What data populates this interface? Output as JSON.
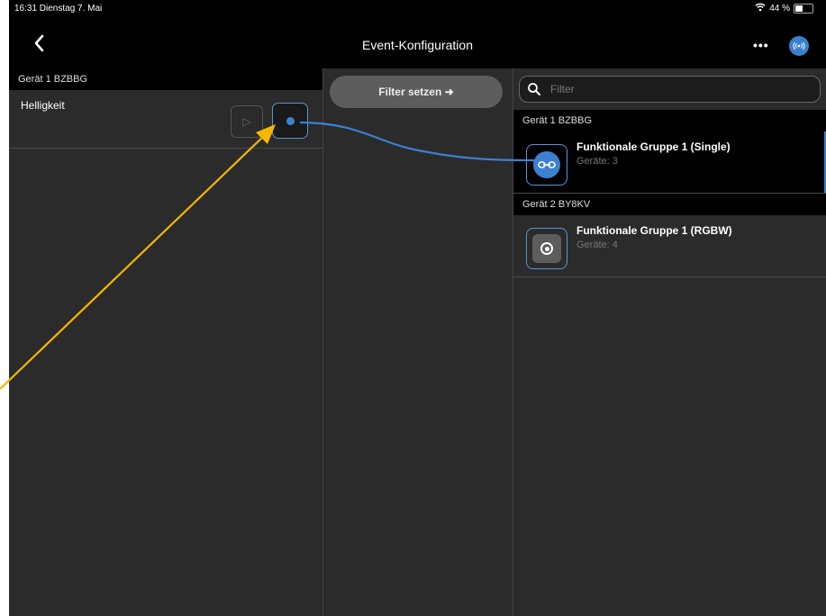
{
  "status": {
    "time_date": "16:31  Dienstag 7. Mai",
    "battery": "44 %"
  },
  "nav": {
    "title": "Event-Konfiguration",
    "more": "•••",
    "live_icon": "live-icon"
  },
  "left": {
    "header": "Gerät 1 BZBBG",
    "param": "Helligkeit"
  },
  "middle": {
    "filter_button": "Filter setzen ➜"
  },
  "right": {
    "search_placeholder": "Filter",
    "sections": [
      {
        "header": "Gerät 1 BZBBG",
        "item": {
          "name": "Funktionale Gruppe 1 (Single)",
          "count": "Geräte: 3"
        }
      },
      {
        "header": "Gerät 2 BY8KV",
        "item": {
          "name": "Funktionale Gruppe 1 (RGBW)",
          "count": "Geräte: 4"
        }
      }
    ]
  },
  "colors": {
    "accent": "#3d80d0",
    "annotation": "#f5b700",
    "background": "#2b2b2b"
  }
}
